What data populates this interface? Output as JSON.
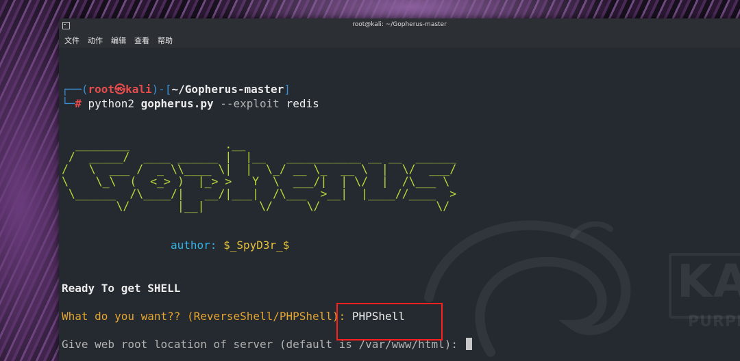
{
  "window": {
    "title": "root@kali: ~/Gopherus-master"
  },
  "menu": [
    {
      "label": "文件"
    },
    {
      "label": "动作"
    },
    {
      "label": "编辑"
    },
    {
      "label": "查看"
    },
    {
      "label": "帮助"
    }
  ],
  "prompt": {
    "corner_top": "┌──(",
    "user": "root",
    "skull": "㉿",
    "host": "kali",
    "mid": ")-[",
    "path": "~/Gopherus-master",
    "end": "]",
    "corner_bottom": "└─",
    "hash": "#"
  },
  "command": {
    "program": "python2",
    "script": "gopherus.py",
    "flag": "--exploit",
    "arg": "redis"
  },
  "banner_ascii": "  ________              .__\n /  _____/  ____ ______ |  |__   ___________ __ __  ______\n/   \\  ___ /  _ \\\\____ \\|  |  \\_/ __ \\_  __ \\  |  \\/  ___/\n\\    \\_\\  (  <_> )  |_> >   Y  \\  ___/|  | \\/  |  /\\___ \\\n \\______  /\\____/|   __/|___|  /\\___  >__|  |____//____  >\n        \\/       |__|        \\/     \\/                 \\/",
  "author": {
    "label": "author:",
    "value": "$_SpyD3r_$"
  },
  "output": {
    "ready": "Ready To get SHELL",
    "question": "What do you want?? (ReverseShell/PHPShell):",
    "answer": "PHPShell",
    "give_root": "Give web root location of server (default is /var/www/html):"
  },
  "watermark": {
    "brand": "KALI",
    "edition": "PURPLE"
  },
  "colors": {
    "terminal_bg": "#242a30",
    "prompt_blue": "#3d8fd1",
    "prompt_red": "#ea4c4c",
    "banner_green": "#b8d73c",
    "author_cyan": "#36b4e8",
    "author_yellow": "#e6c23a",
    "question_orange": "#e6a52e",
    "highlight_red": "#ff1f1f"
  }
}
